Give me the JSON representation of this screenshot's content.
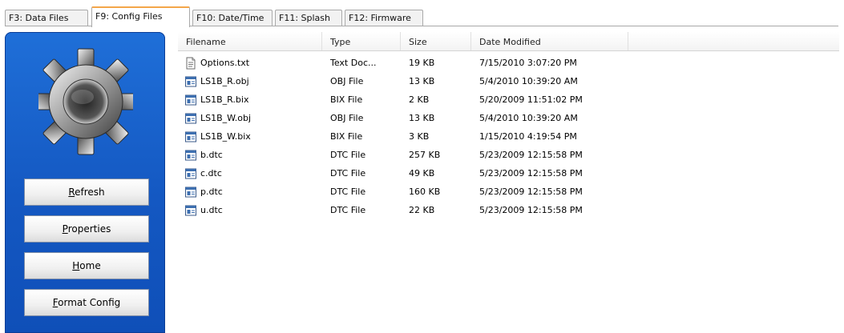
{
  "tabs": [
    {
      "label": "F3: Data Files",
      "active": false
    },
    {
      "label": "F9: Config Files",
      "active": true
    },
    {
      "label": "F10: Date/Time",
      "active": false
    },
    {
      "label": "F11: Splash",
      "active": false
    },
    {
      "label": "F12: Firmware",
      "active": false
    }
  ],
  "panel": {
    "icon": "gear-icon",
    "buttons": [
      {
        "accel": "R",
        "rest": "efresh"
      },
      {
        "accel": "P",
        "rest": "roperties"
      },
      {
        "accel": "H",
        "rest": "ome"
      },
      {
        "accel": "F",
        "rest": "ormat Config"
      }
    ]
  },
  "columns": [
    "Filename",
    "Type",
    "Size",
    "Date Modified"
  ],
  "files": [
    {
      "name": "Options.txt",
      "type": "Text Doc...",
      "size": "19 KB",
      "modified": "7/15/2010 3:07:20 PM",
      "icon": "text-file-icon"
    },
    {
      "name": "LS1B_R.obj",
      "type": "OBJ File",
      "size": "13 KB",
      "modified": "5/4/2010 10:39:20 AM",
      "icon": "file-icon"
    },
    {
      "name": "LS1B_R.bix",
      "type": "BIX File",
      "size": "2 KB",
      "modified": "5/20/2009 11:51:02 PM",
      "icon": "file-icon"
    },
    {
      "name": "LS1B_W.obj",
      "type": "OBJ File",
      "size": "13 KB",
      "modified": "5/4/2010 10:39:20 AM",
      "icon": "file-icon"
    },
    {
      "name": "LS1B_W.bix",
      "type": "BIX File",
      "size": "3 KB",
      "modified": "1/15/2010 4:19:54 PM",
      "icon": "file-icon"
    },
    {
      "name": "b.dtc",
      "type": "DTC File",
      "size": "257 KB",
      "modified": "5/23/2009 12:15:58 PM",
      "icon": "file-icon"
    },
    {
      "name": "c.dtc",
      "type": "DTC File",
      "size": "49 KB",
      "modified": "5/23/2009 12:15:58 PM",
      "icon": "file-icon"
    },
    {
      "name": "p.dtc",
      "type": "DTC File",
      "size": "160 KB",
      "modified": "5/23/2009 12:15:58 PM",
      "icon": "file-icon"
    },
    {
      "name": "u.dtc",
      "type": "DTC File",
      "size": "22 KB",
      "modified": "5/23/2009 12:15:58 PM",
      "icon": "file-icon"
    }
  ],
  "colors": {
    "panel": "#1458c2",
    "active_tab_accent": "#f4a64a"
  }
}
